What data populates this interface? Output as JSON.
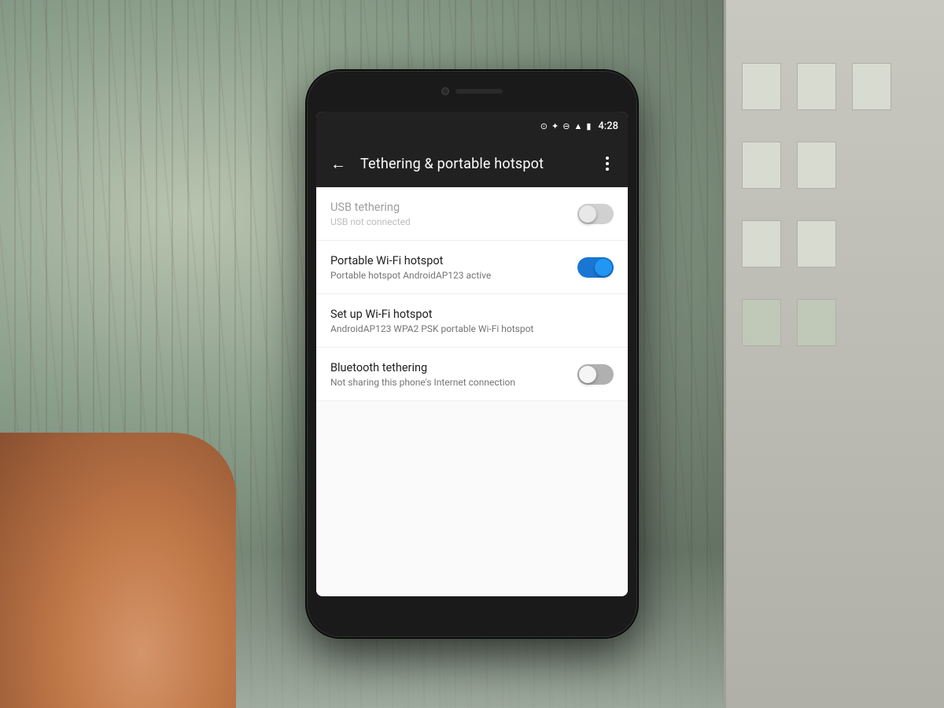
{
  "background": {
    "description": "Winter outdoor scene with trees and building"
  },
  "phone": {
    "status_bar": {
      "time": "4:28",
      "icons": [
        "wifi-calling",
        "bluetooth",
        "data-saver",
        "signal",
        "battery"
      ]
    },
    "app_bar": {
      "title": "Tethering & portable hotspot",
      "back_label": "←",
      "more_label": "⋮"
    },
    "settings": {
      "items": [
        {
          "id": "usb_tethering",
          "title": "USB tethering",
          "subtitle": "USB not connected",
          "toggle_state": "disabled",
          "has_toggle": true,
          "is_disabled": true
        },
        {
          "id": "portable_wifi",
          "title": "Portable Wi-Fi hotspot",
          "subtitle": "Portable hotspot AndroidAP123 active",
          "toggle_state": "on",
          "has_toggle": true,
          "is_disabled": false
        },
        {
          "id": "setup_wifi",
          "title": "Set up Wi-Fi hotspot",
          "subtitle": "AndroidAP123 WPA2 PSK portable Wi-Fi hotspot",
          "toggle_state": "none",
          "has_toggle": false,
          "is_disabled": false
        },
        {
          "id": "bluetooth_tethering",
          "title": "Bluetooth tethering",
          "subtitle": "Not sharing this phone's Internet connection",
          "toggle_state": "off",
          "has_toggle": true,
          "is_disabled": false
        }
      ]
    }
  }
}
